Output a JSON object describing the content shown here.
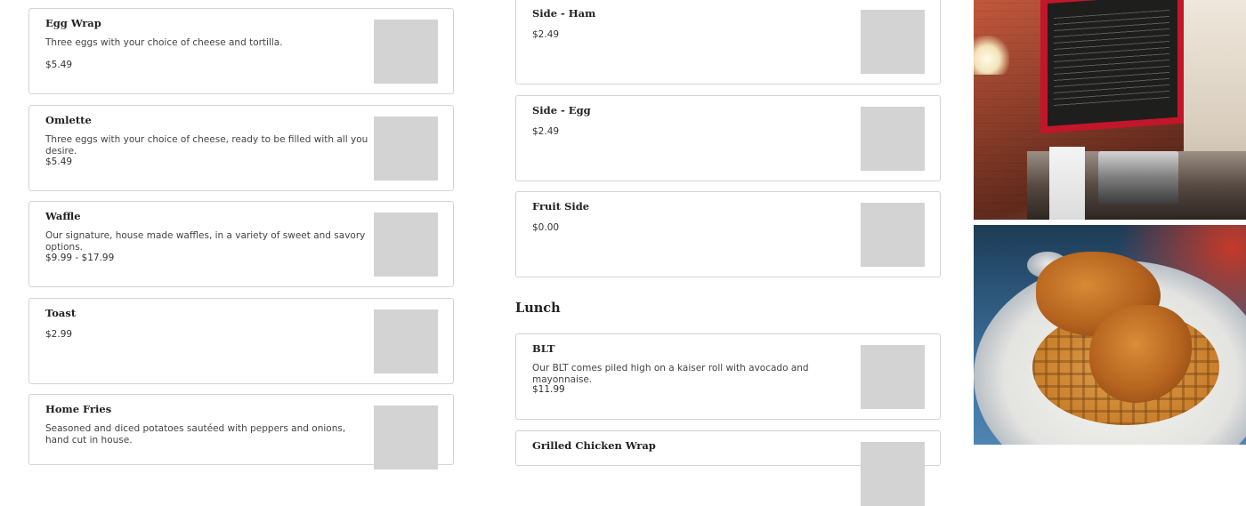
{
  "left_column": {
    "items": [
      {
        "name": "Egg Wrap",
        "description": "Three eggs with your choice of cheese and tortilla.",
        "price": "$5.49"
      },
      {
        "name": "Omlette",
        "description": "Three eggs with your choice of cheese, ready to be filled with all you desire.",
        "price": "$5.49"
      },
      {
        "name": "Waffle",
        "description": "Our signature, house made waffles, in a variety of sweet and savory options.",
        "price": "$9.99 - $17.99"
      },
      {
        "name": "Toast",
        "description": "",
        "price": "$2.99"
      },
      {
        "name": "Home Fries",
        "description": "Seasoned and diced potatoes sautéed with peppers and onions, hand cut in house.",
        "price": ""
      }
    ]
  },
  "middle_column": {
    "items": [
      {
        "name": "Side - Ham",
        "price": "$2.49"
      },
      {
        "name": "Side - Egg",
        "price": "$2.49"
      },
      {
        "name": "Fruit Side",
        "price": "$0.00"
      }
    ],
    "lunch_title": "Lunch",
    "lunch_items": [
      {
        "name": "BLT",
        "description": "Our BLT comes piled high on a kaiser roll with avocado and mayonnaise.",
        "price": "$11.99"
      },
      {
        "name": "Grilled Chicken Wrap"
      }
    ]
  },
  "colors": {
    "card_border": "#d4d4d4",
    "thumb_placeholder": "#d3d3d3"
  }
}
